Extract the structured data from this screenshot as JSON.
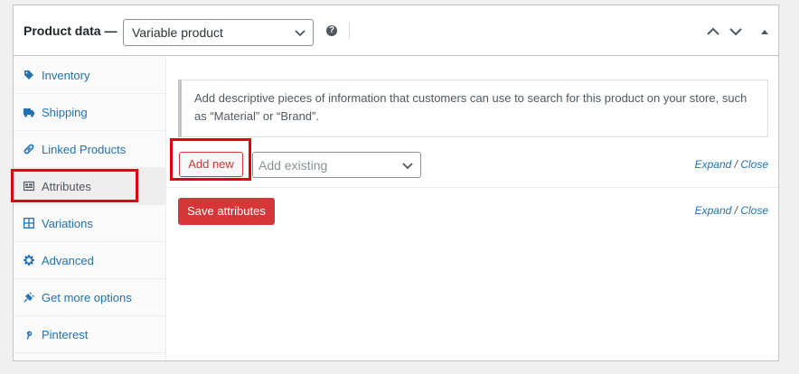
{
  "header": {
    "title": "Product data —",
    "product_type": "Variable product",
    "help_icon": "?"
  },
  "sidebar": {
    "items": [
      {
        "label": "Inventory",
        "icon": "tag-icon"
      },
      {
        "label": "Shipping",
        "icon": "truck-icon"
      },
      {
        "label": "Linked Products",
        "icon": "link-icon"
      },
      {
        "label": "Attributes",
        "icon": "list-view-icon",
        "active": true
      },
      {
        "label": "Variations",
        "icon": "grid-icon"
      },
      {
        "label": "Advanced",
        "icon": "gear-icon"
      },
      {
        "label": "Get more options",
        "icon": "plugin-icon"
      },
      {
        "label": "Pinterest",
        "icon": "pinterest-icon"
      }
    ]
  },
  "main": {
    "notice_text": "Add descriptive pieces of information that customers can use to search for this product on your store, such as “Material” or “Brand”.",
    "add_new_label": "Add new",
    "add_existing_placeholder": "Add existing",
    "expand_label": "Expand",
    "slash": " / ",
    "close_label": "Close",
    "save_label": "Save attributes"
  },
  "colors": {
    "link": "#2271b1",
    "danger": "#d63638",
    "annotation": "#e4000f"
  }
}
